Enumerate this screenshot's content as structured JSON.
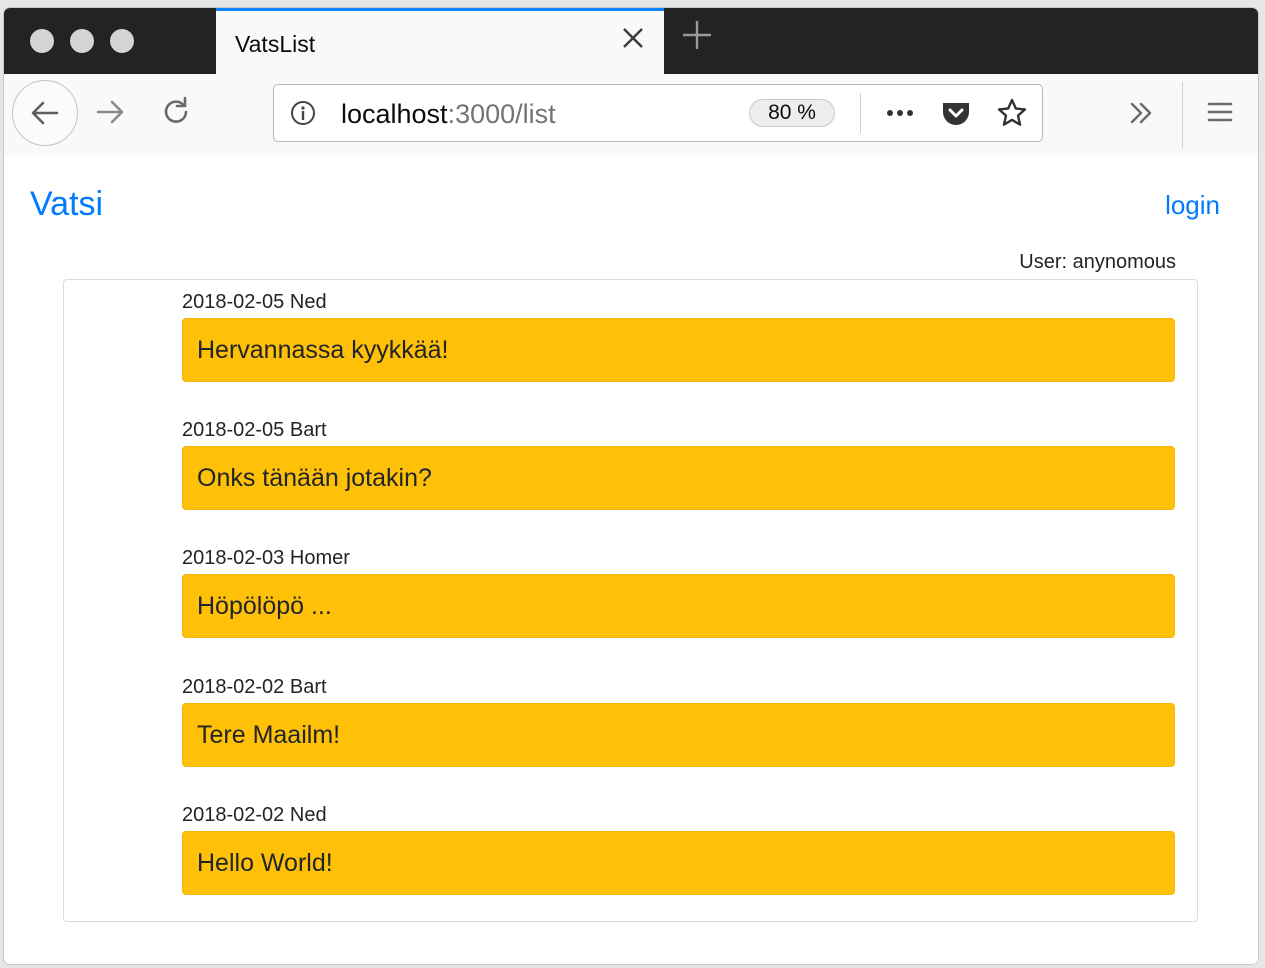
{
  "browser": {
    "tab_title": "VatsList",
    "url_host": "localhost",
    "url_path": ":3000/list",
    "zoom": "80 %"
  },
  "navbar": {
    "brand": "Vatsi",
    "login_label": "login"
  },
  "user_line": "User: anynomous",
  "messages": [
    {
      "date": "2018-02-05",
      "author": "Ned",
      "text": "Hervannassa kyykkää!"
    },
    {
      "date": "2018-02-05",
      "author": "Bart",
      "text": "Onks tänään jotakin?"
    },
    {
      "date": "2018-02-03",
      "author": "Homer",
      "text": "Höpölöpö ..."
    },
    {
      "date": "2018-02-02",
      "author": "Bart",
      "text": "Tere Maailm!"
    },
    {
      "date": "2018-02-02",
      "author": "Ned",
      "text": "Hello World!"
    }
  ],
  "colors": {
    "accent": "#007bff",
    "message_bg": "#ffc107",
    "tab_highlight": "#0a84ff"
  }
}
